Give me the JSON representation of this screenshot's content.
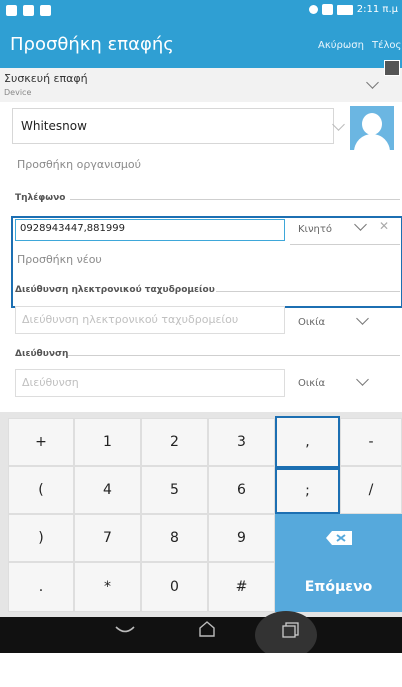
{
  "status_bar": {
    "time": "2:11 π.μ"
  },
  "app_bar": {
    "title": "Προσθήκη επαφής",
    "cancel": "Ακύρωση",
    "done": "Τέλος"
  },
  "device": {
    "title": "Συσκευή επαφή",
    "subtitle": "Device"
  },
  "name": {
    "value": "Whitesnow"
  },
  "add_organization": "Προσθήκη οργανισμού",
  "phone": {
    "section_label": "Τηλέφωνο",
    "value": "0928943447,881999",
    "type": "Κινητό",
    "add_new": "Προσθήκη νέου"
  },
  "email": {
    "section_label": "Διεύθυνση ηλεκτρονικού ταχυδρομείου",
    "placeholder": "Διεύθυνση ηλεκτρονικού ταχυδρομείου",
    "type": "Οικία"
  },
  "address": {
    "section_label": "Διεύθυνση",
    "placeholder": "Διεύθυνση",
    "type": "Οικία"
  },
  "keypad": {
    "rows": [
      [
        "+",
        "1",
        "2",
        "3",
        ",",
        "-"
      ],
      [
        "(",
        "4",
        "5",
        "6",
        ";",
        "/"
      ],
      [
        ")",
        "7",
        "8",
        "9"
      ],
      [
        ".",
        "*",
        "0",
        "#"
      ]
    ],
    "next_label": "Επόμενο",
    "backspace_icon": "backspace-icon",
    "accent_color": "#56a9dc"
  },
  "nav": {
    "back_icon": "back-icon",
    "home_icon": "home-icon",
    "recents_icon": "recents-icon"
  }
}
